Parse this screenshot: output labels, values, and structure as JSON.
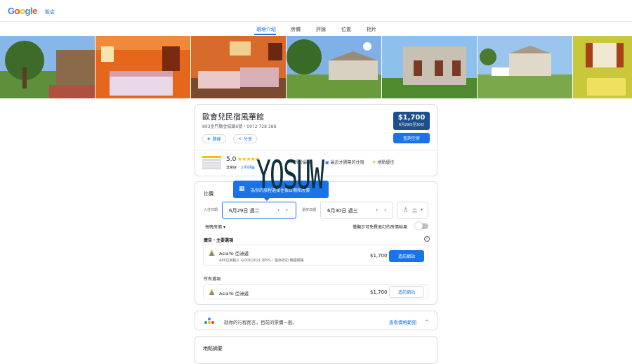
{
  "header": {
    "logo": "Google",
    "logo_colors": [
      "#4285F4",
      "#EA4335",
      "#FBBC05",
      "#4285F4",
      "#34A853",
      "#EA4335"
    ],
    "hotels_link": "飯店"
  },
  "tabs": [
    {
      "label": "環境介紹",
      "active": true
    },
    {
      "label": "房價",
      "active": false
    },
    {
      "label": "評論",
      "active": false
    },
    {
      "label": "位置",
      "active": false
    },
    {
      "label": "相片",
      "active": false
    }
  ],
  "hotel": {
    "name": "歐會兒民宿風華館",
    "address": "893金門縣金城鎮6號・0972 728 388",
    "directions_label": "路線",
    "share_label": "分享",
    "price": "$1,700",
    "price_dates": "6月29日至30日",
    "check_availability": "查詢空房",
    "rating": "5.0",
    "rating_word": "非常好",
    "reviews": "3 則評論",
    "feature_1": "評分最高",
    "feature_2": "最近才開幕的住宿",
    "feature_3": "地點優佳"
  },
  "watermark": "YOSUW",
  "prices": {
    "title": "比價",
    "tooltip": "為你的旅程選擇住宿日期和房價",
    "checkin_label": "入住日期",
    "checkin_value": "6月29日 週二",
    "checkout_label": "退房日期",
    "checkout_value": "6月30日 週三",
    "guests_value": "二",
    "nightly_label": "每晚房價",
    "free_cancel_label": "僅顯示可免費退訂的房價結果",
    "ads_heading": "廣告・主要選項",
    "ad_offer": {
      "provider": "AsiaYo 亞洲遊",
      "subtitle": "APP訂房輸入 GOOD2021 折6%・還存折扣 韓國網路",
      "price": "$1,700",
      "button": "造訪網站"
    },
    "all_heading": "所有選項",
    "offer": {
      "provider": "AsiaYo 亞洲遊",
      "price": "$1,700",
      "button": "造訪網站"
    }
  },
  "trip_note": {
    "text": "就你的行程而言，目前的票價一般。",
    "link": "查看價格範圍"
  },
  "location": {
    "title": "地點摘要"
  }
}
